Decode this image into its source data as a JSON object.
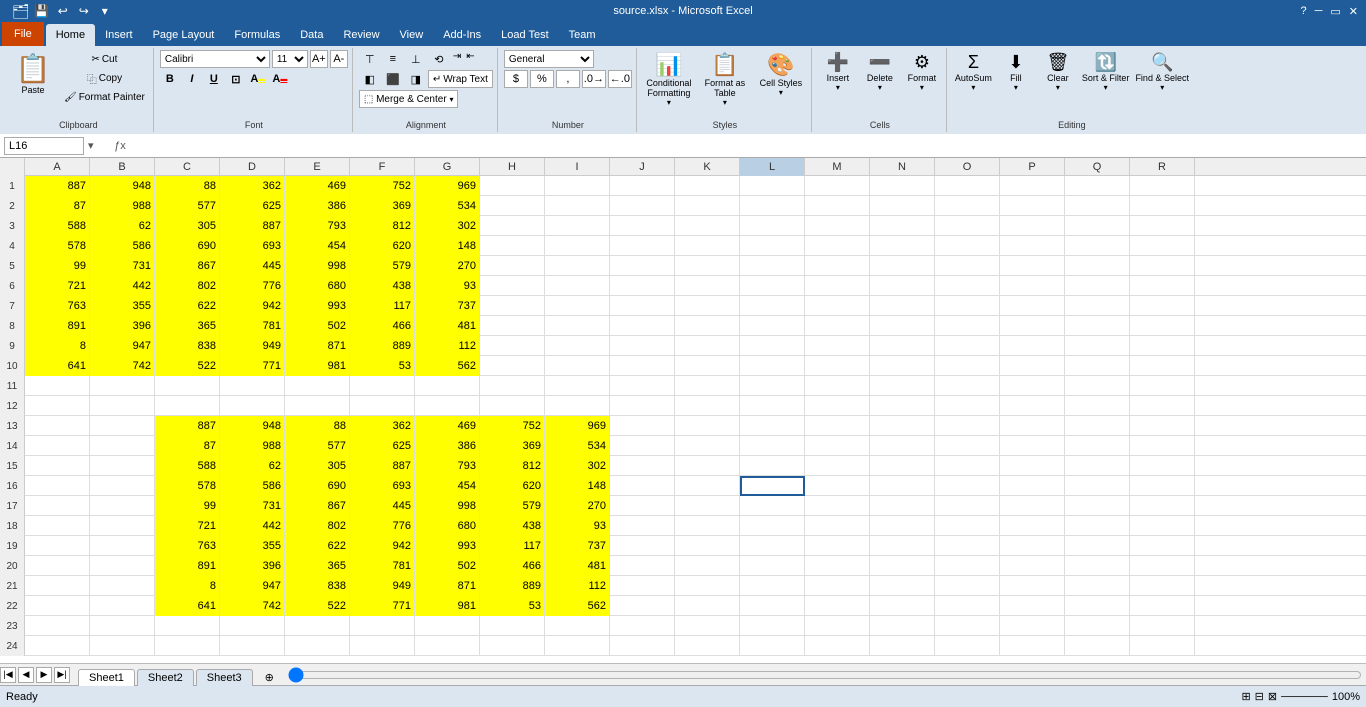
{
  "titlebar": {
    "title": "source.xlsx - Microsoft Excel",
    "quickaccess": [
      "💾",
      "↩",
      "↪",
      "▾"
    ]
  },
  "ribbon": {
    "tabs": [
      "File",
      "Home",
      "Insert",
      "Page Layout",
      "Formulas",
      "Data",
      "Review",
      "View",
      "Add-Ins",
      "Load Test",
      "Team"
    ],
    "active_tab": "Home",
    "groups": {
      "clipboard": {
        "label": "Clipboard",
        "paste_label": "Paste",
        "cut_label": "Cut",
        "copy_label": "Copy",
        "format_painter_label": "Format Painter"
      },
      "font": {
        "label": "Font",
        "font_name": "Calibri",
        "font_size": "11"
      },
      "alignment": {
        "label": "Alignment",
        "wrap_text": "Wrap Text",
        "merge_center": "Merge & Center"
      },
      "number": {
        "label": "Number",
        "format": "General"
      },
      "styles": {
        "label": "Styles",
        "conditional_formatting": "Conditional Formatting",
        "format_as_table": "Format as Table",
        "cell_styles": "Cell Styles"
      },
      "cells": {
        "label": "Cells",
        "insert": "Insert",
        "delete": "Delete",
        "format": "Format"
      },
      "editing": {
        "label": "Editing",
        "autosum": "AutoSum",
        "fill": "Fill",
        "clear": "Clear",
        "sort_filter": "Sort & Filter",
        "find_select": "Find & Select"
      }
    }
  },
  "formulabar": {
    "cell_ref": "L16",
    "formula": ""
  },
  "columns": [
    "A",
    "B",
    "C",
    "D",
    "E",
    "F",
    "G",
    "H",
    "I",
    "J",
    "K",
    "L",
    "M",
    "N",
    "O",
    "P",
    "Q",
    "R"
  ],
  "rows": [
    {
      "num": 1,
      "cells": [
        887,
        948,
        88,
        362,
        469,
        752,
        969,
        null,
        null,
        null,
        null,
        null,
        null,
        null,
        null,
        null,
        null,
        null
      ],
      "yellow": [
        0,
        1,
        2,
        3,
        4,
        5,
        6
      ]
    },
    {
      "num": 2,
      "cells": [
        87,
        988,
        577,
        625,
        386,
        369,
        534,
        null,
        null,
        null,
        null,
        null,
        null,
        null,
        null,
        null,
        null,
        null
      ],
      "yellow": [
        0,
        1,
        2,
        3,
        4,
        5,
        6
      ]
    },
    {
      "num": 3,
      "cells": [
        588,
        62,
        305,
        887,
        793,
        812,
        302,
        null,
        null,
        null,
        null,
        null,
        null,
        null,
        null,
        null,
        null,
        null
      ],
      "yellow": [
        0,
        1,
        2,
        3,
        4,
        5,
        6
      ]
    },
    {
      "num": 4,
      "cells": [
        578,
        586,
        690,
        693,
        454,
        620,
        148,
        null,
        null,
        null,
        null,
        null,
        null,
        null,
        null,
        null,
        null,
        null
      ],
      "yellow": [
        0,
        1,
        2,
        3,
        4,
        5,
        6
      ]
    },
    {
      "num": 5,
      "cells": [
        99,
        731,
        867,
        445,
        998,
        579,
        270,
        null,
        null,
        null,
        null,
        null,
        null,
        null,
        null,
        null,
        null,
        null
      ],
      "yellow": [
        0,
        1,
        2,
        3,
        4,
        5,
        6
      ]
    },
    {
      "num": 6,
      "cells": [
        721,
        442,
        802,
        776,
        680,
        438,
        93,
        null,
        null,
        null,
        null,
        null,
        null,
        null,
        null,
        null,
        null,
        null
      ],
      "yellow": [
        0,
        1,
        2,
        3,
        4,
        5,
        6
      ]
    },
    {
      "num": 7,
      "cells": [
        763,
        355,
        622,
        942,
        993,
        117,
        737,
        null,
        null,
        null,
        null,
        null,
        null,
        null,
        null,
        null,
        null,
        null
      ],
      "yellow": [
        0,
        1,
        2,
        3,
        4,
        5,
        6
      ]
    },
    {
      "num": 8,
      "cells": [
        891,
        396,
        365,
        781,
        502,
        466,
        481,
        null,
        null,
        null,
        null,
        null,
        null,
        null,
        null,
        null,
        null,
        null
      ],
      "yellow": [
        0,
        1,
        2,
        3,
        4,
        5,
        6
      ]
    },
    {
      "num": 9,
      "cells": [
        8,
        947,
        838,
        949,
        871,
        889,
        112,
        null,
        null,
        null,
        null,
        null,
        null,
        null,
        null,
        null,
        null,
        null
      ],
      "yellow": [
        0,
        1,
        2,
        3,
        4,
        5,
        6
      ]
    },
    {
      "num": 10,
      "cells": [
        641,
        742,
        522,
        771,
        981,
        53,
        562,
        null,
        null,
        null,
        null,
        null,
        null,
        null,
        null,
        null,
        null,
        null
      ],
      "yellow": [
        0,
        1,
        2,
        3,
        4,
        5,
        6
      ]
    },
    {
      "num": 11,
      "cells": [
        null,
        null,
        null,
        null,
        null,
        null,
        null,
        null,
        null,
        null,
        null,
        null,
        null,
        null,
        null,
        null,
        null,
        null
      ],
      "yellow": []
    },
    {
      "num": 12,
      "cells": [
        null,
        null,
        null,
        null,
        null,
        null,
        null,
        null,
        null,
        null,
        null,
        null,
        null,
        null,
        null,
        null,
        null,
        null
      ],
      "yellow": []
    },
    {
      "num": 13,
      "cells": [
        null,
        null,
        887,
        948,
        88,
        362,
        469,
        752,
        969,
        null,
        null,
        null,
        null,
        null,
        null,
        null,
        null,
        null
      ],
      "yellow": [
        2,
        3,
        4,
        5,
        6,
        7,
        8
      ]
    },
    {
      "num": 14,
      "cells": [
        null,
        null,
        87,
        988,
        577,
        625,
        386,
        369,
        534,
        null,
        null,
        null,
        null,
        null,
        null,
        null,
        null,
        null
      ],
      "yellow": [
        2,
        3,
        4,
        5,
        6,
        7,
        8
      ]
    },
    {
      "num": 15,
      "cells": [
        null,
        null,
        588,
        62,
        305,
        887,
        793,
        812,
        302,
        null,
        null,
        null,
        null,
        null,
        null,
        null,
        null,
        null
      ],
      "yellow": [
        2,
        3,
        4,
        5,
        6,
        7,
        8
      ]
    },
    {
      "num": 16,
      "cells": [
        null,
        null,
        578,
        586,
        690,
        693,
        454,
        620,
        148,
        null,
        null,
        null,
        null,
        null,
        null,
        null,
        null,
        null
      ],
      "yellow": [
        2,
        3,
        4,
        5,
        6,
        7,
        8
      ],
      "selected_col": 11
    },
    {
      "num": 17,
      "cells": [
        null,
        null,
        99,
        731,
        867,
        445,
        998,
        579,
        270,
        null,
        null,
        null,
        null,
        null,
        null,
        null,
        null,
        null
      ],
      "yellow": [
        2,
        3,
        4,
        5,
        6,
        7,
        8
      ]
    },
    {
      "num": 18,
      "cells": [
        null,
        null,
        721,
        442,
        802,
        776,
        680,
        438,
        93,
        null,
        null,
        null,
        null,
        null,
        null,
        null,
        null,
        null
      ],
      "yellow": [
        2,
        3,
        4,
        5,
        6,
        7,
        8
      ]
    },
    {
      "num": 19,
      "cells": [
        null,
        null,
        763,
        355,
        622,
        942,
        993,
        117,
        737,
        null,
        null,
        null,
        null,
        null,
        null,
        null,
        null,
        null
      ],
      "yellow": [
        2,
        3,
        4,
        5,
        6,
        7,
        8
      ]
    },
    {
      "num": 20,
      "cells": [
        null,
        null,
        891,
        396,
        365,
        781,
        502,
        466,
        481,
        null,
        null,
        null,
        null,
        null,
        null,
        null,
        null,
        null
      ],
      "yellow": [
        2,
        3,
        4,
        5,
        6,
        7,
        8
      ]
    },
    {
      "num": 21,
      "cells": [
        null,
        null,
        8,
        947,
        838,
        949,
        871,
        889,
        112,
        null,
        null,
        null,
        null,
        null,
        null,
        null,
        null,
        null
      ],
      "yellow": [
        2,
        3,
        4,
        5,
        6,
        7,
        8
      ]
    },
    {
      "num": 22,
      "cells": [
        null,
        null,
        641,
        742,
        522,
        771,
        981,
        53,
        562,
        null,
        null,
        null,
        null,
        null,
        null,
        null,
        null,
        null
      ],
      "yellow": [
        2,
        3,
        4,
        5,
        6,
        7,
        8
      ]
    },
    {
      "num": 23,
      "cells": [
        null,
        null,
        null,
        null,
        null,
        null,
        null,
        null,
        null,
        null,
        null,
        null,
        null,
        null,
        null,
        null,
        null,
        null
      ],
      "yellow": []
    },
    {
      "num": 24,
      "cells": [
        null,
        null,
        null,
        null,
        null,
        null,
        null,
        null,
        null,
        null,
        null,
        null,
        null,
        null,
        null,
        null,
        null,
        null
      ],
      "yellow": []
    }
  ],
  "sheets": [
    "Sheet1",
    "Sheet2",
    "Sheet3"
  ],
  "active_sheet": "Sheet1",
  "status": {
    "ready": "Ready",
    "zoom": "100%"
  }
}
